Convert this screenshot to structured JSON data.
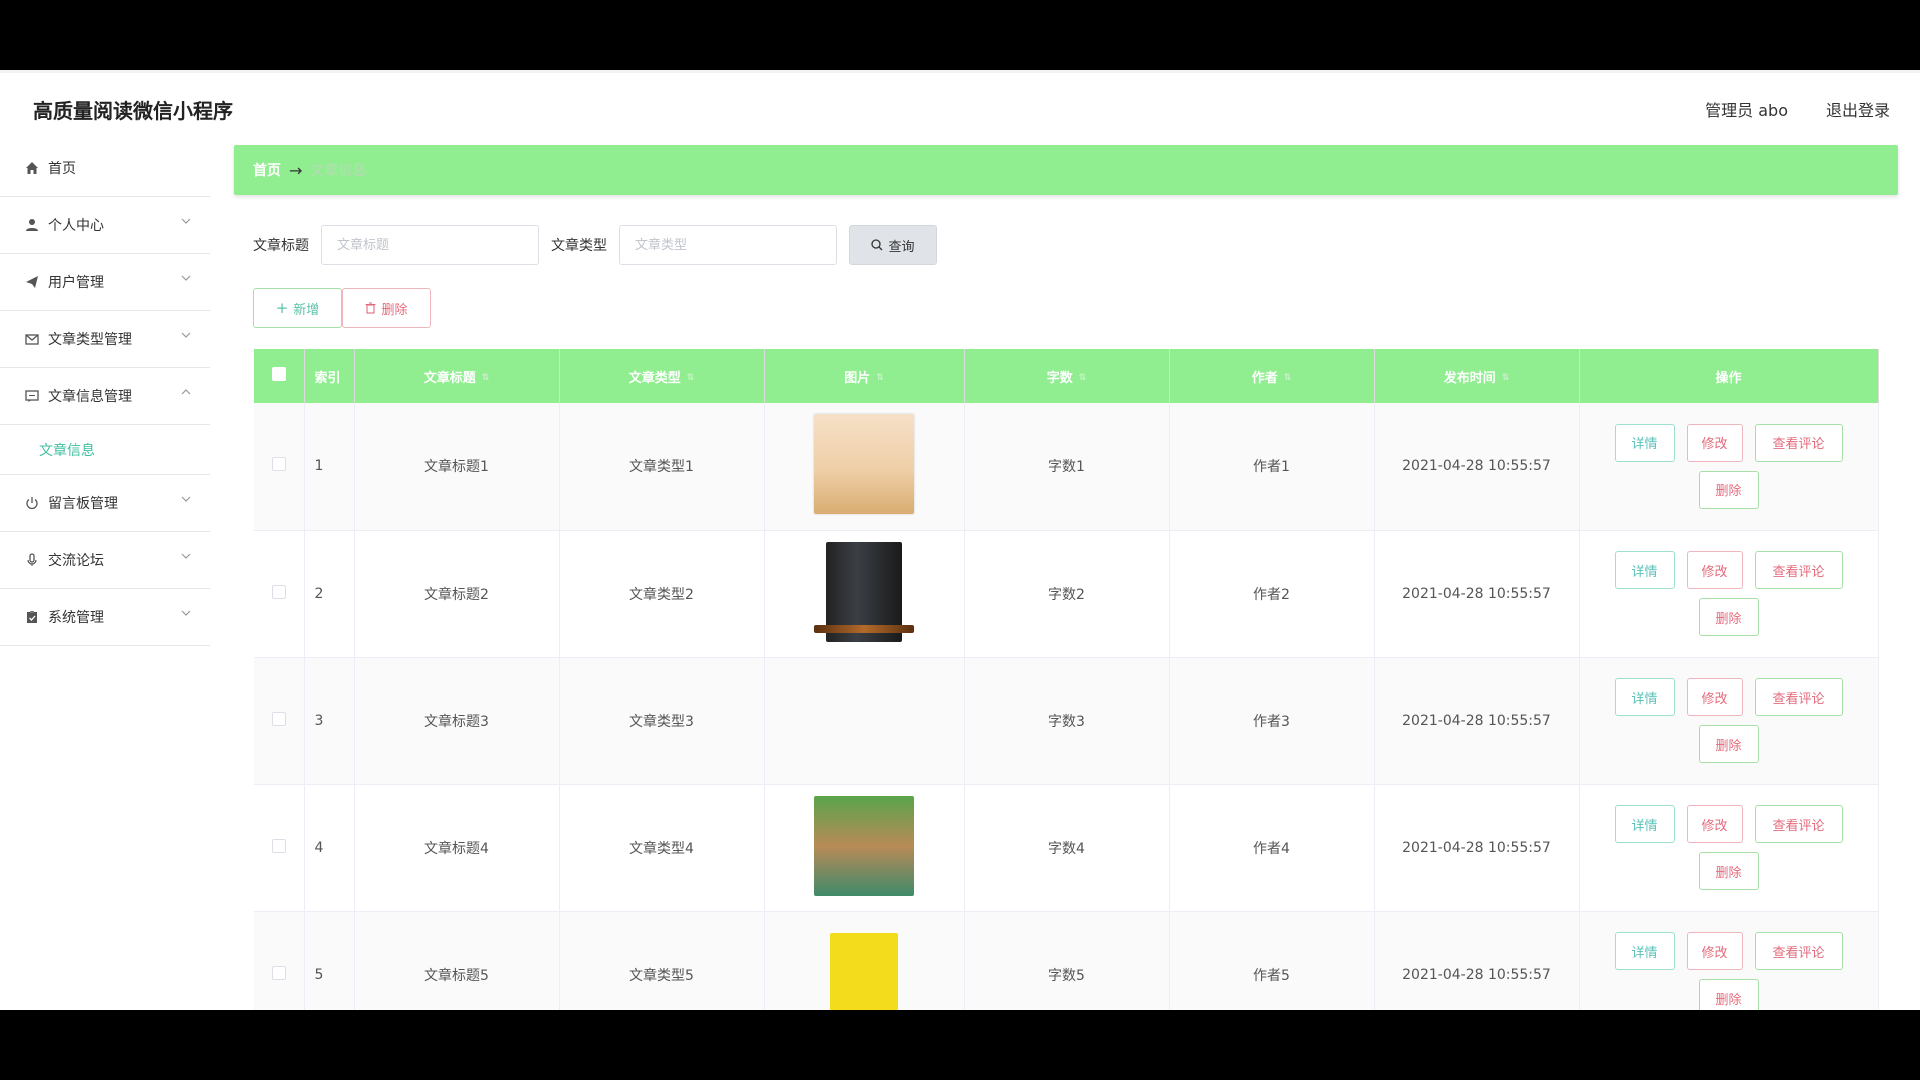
{
  "header": {
    "title": "高质量阅读微信小程序",
    "admin": "管理员 abo",
    "logout": "退出登录"
  },
  "sidebar": {
    "home": "首页",
    "items": [
      {
        "label": "个人中心",
        "icon": "user-icon"
      },
      {
        "label": "用户管理",
        "icon": "send-icon"
      },
      {
        "label": "文章类型管理",
        "icon": "mail-icon"
      },
      {
        "label": "文章信息管理",
        "icon": "message-icon"
      }
    ],
    "sub_item": "文章信息",
    "items2": [
      {
        "label": "留言板管理",
        "icon": "power-icon"
      },
      {
        "label": "交流论坛",
        "icon": "mic-icon"
      },
      {
        "label": "系统管理",
        "icon": "clipboard-icon"
      }
    ]
  },
  "breadcrumb": {
    "home": "首页",
    "arrow": "→",
    "current": "文章信息"
  },
  "filter": {
    "title_label": "文章标题",
    "title_placeholder": "文章标题",
    "type_label": "文章类型",
    "type_placeholder": "文章类型",
    "query": "查询"
  },
  "toolbar": {
    "add": "新增",
    "delete": "删除"
  },
  "table": {
    "columns": [
      "索引",
      "文章标题",
      "文章类型",
      "图片",
      "字数",
      "作者",
      "发布时间",
      "操作"
    ],
    "rows": [
      {
        "index": "1",
        "title": "文章标题1",
        "type": "文章类型1",
        "words": "字数1",
        "author": "作者1",
        "time": "2021-04-28 10:55:57"
      },
      {
        "index": "2",
        "title": "文章标题2",
        "type": "文章类型2",
        "words": "字数2",
        "author": "作者2",
        "time": "2021-04-28 10:55:57"
      },
      {
        "index": "3",
        "title": "文章标题3",
        "type": "文章类型3",
        "words": "字数3",
        "author": "作者3",
        "time": "2021-04-28 10:55:57"
      },
      {
        "index": "4",
        "title": "文章标题4",
        "type": "文章类型4",
        "words": "字数4",
        "author": "作者4",
        "time": "2021-04-28 10:55:57"
      },
      {
        "index": "5",
        "title": "文章标题5",
        "type": "文章类型5",
        "words": "字数5",
        "author": "作者5",
        "time": "2021-04-28 10:55:57"
      }
    ],
    "ops": {
      "detail": "详情",
      "edit": "修改",
      "view_comments": "查看评论",
      "delete": "删除"
    }
  },
  "colors": {
    "accent": "#90ee90",
    "teal": "#40bfa0",
    "danger": "#e46b7c"
  }
}
